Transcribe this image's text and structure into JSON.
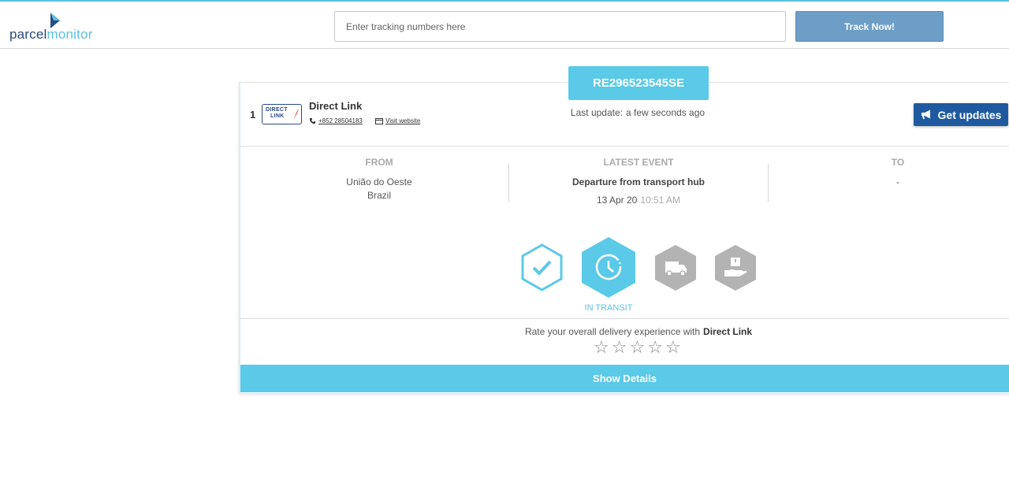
{
  "brand": {
    "part1": "parcel",
    "part2": "monitor"
  },
  "search": {
    "placeholder": "Enter tracking numbers here",
    "button": "Track Now!"
  },
  "shipment": {
    "tracking_number": "RE296523545SE",
    "last_update_label": "Last update:",
    "last_update_value": "a few seconds ago",
    "index": "1",
    "carrier": {
      "logo_line1": "DIRECT",
      "logo_line2": "LINK",
      "name": "Direct Link",
      "phone": "+852 28504183",
      "website_label": "Visit website"
    },
    "get_updates": "Get updates",
    "from": {
      "header": "FROM",
      "line1": "União do Oeste",
      "line2": "Brazil"
    },
    "latest_event": {
      "header": "LATEST EVENT",
      "title": "Departure from transport hub",
      "date": "13 Apr 20",
      "time": "10:51 AM"
    },
    "to": {
      "header": "TO",
      "value": "-"
    },
    "status_label": "IN TRANSIT",
    "steps": [
      "check-icon",
      "clock-icon",
      "truck-icon",
      "hand-package-icon"
    ],
    "active_step": 1,
    "rating": {
      "prompt": "Rate your overall delivery experience with",
      "carrier": "Direct Link",
      "stars": 5
    },
    "show_details": "Show Details"
  },
  "colors": {
    "accent": "#5bc9e8",
    "button_blue": "#6d9ec7",
    "dark_blue": "#1f5aa0",
    "inactive": "#b3b3b3"
  }
}
